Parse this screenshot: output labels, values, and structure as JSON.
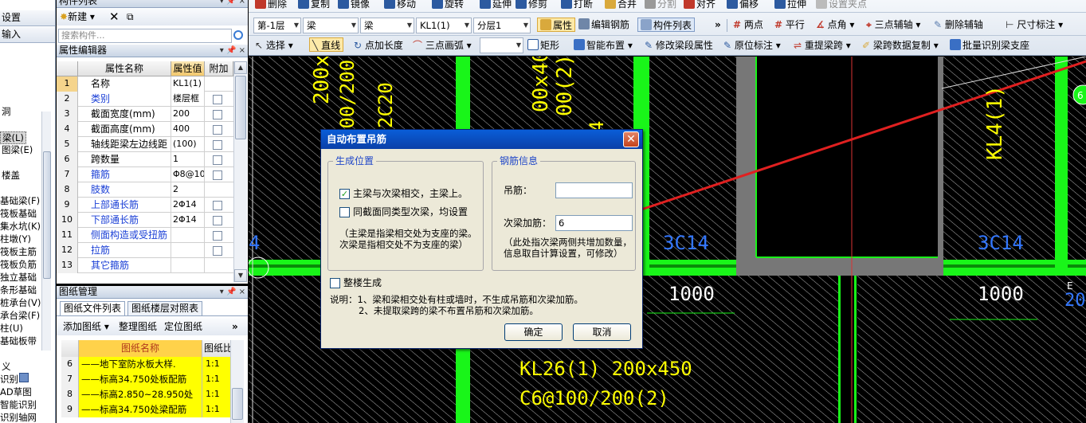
{
  "left_strip": {
    "buttons": [
      "设置",
      "输入"
    ],
    "items": [
      "洞",
      "梁(L)",
      "图梁(E)",
      "楼盖",
      "基础梁(F)",
      "筏板基础",
      "集水坑(K)",
      "柱墩(Y)",
      "筏板主筋",
      "筏板负筋",
      "独立基础",
      "条形基础",
      "桩承台(V)",
      "承台梁(F)",
      "柱(U)",
      "基础板带",
      "义",
      "识别",
      "AD草图",
      "智能识别",
      "识别轴网"
    ]
  },
  "component_list": {
    "title": "构件列表",
    "new_label": "新建",
    "search_placeholder": "搜索构件..."
  },
  "property_editor": {
    "title": "属性编辑器",
    "columns": [
      "属性名称",
      "属性值",
      "附加"
    ],
    "rows": [
      {
        "num": "1",
        "name": "名称",
        "value": "KL1(1)",
        "blue": false,
        "check": false,
        "selected": true
      },
      {
        "num": "2",
        "name": "类别",
        "value": "楼层框",
        "blue": true,
        "check": true
      },
      {
        "num": "3",
        "name": "截面宽度(mm)",
        "value": "200",
        "blue": false,
        "check": true
      },
      {
        "num": "4",
        "name": "截面高度(mm)",
        "value": "400",
        "blue": false,
        "check": true
      },
      {
        "num": "5",
        "name": "轴线距梁左边线距",
        "value": "(100)",
        "blue": false,
        "check": true
      },
      {
        "num": "6",
        "name": "跨数量",
        "value": "1",
        "blue": false,
        "check": true
      },
      {
        "num": "7",
        "name": "箍筋",
        "value": "Φ8@10",
        "blue": true,
        "check": true
      },
      {
        "num": "8",
        "name": "肢数",
        "value": "2",
        "blue": true,
        "check": false
      },
      {
        "num": "9",
        "name": "上部通长筋",
        "value": "2Φ14",
        "blue": true,
        "check": true
      },
      {
        "num": "10",
        "name": "下部通长筋",
        "value": "2Φ14",
        "blue": true,
        "check": true
      },
      {
        "num": "11",
        "name": "侧面构造或受扭筋",
        "value": "",
        "blue": true,
        "check": true
      },
      {
        "num": "12",
        "name": "拉筋",
        "value": "",
        "blue": true,
        "check": true
      },
      {
        "num": "13",
        "name": "其它箍筋",
        "value": "",
        "blue": true,
        "check": false
      }
    ]
  },
  "drawing_management": {
    "title": "图纸管理",
    "tabs": [
      "图纸文件列表",
      "图纸楼层对照表"
    ],
    "buttons": [
      "添加图纸",
      "整理图纸",
      "定位图纸"
    ],
    "columns": [
      "图纸名称",
      "图纸比"
    ],
    "rows": [
      {
        "num": "6",
        "name": "——地下室防水板大样.",
        "scale": "1:1"
      },
      {
        "num": "7",
        "name": "——标高34.750处板配筋",
        "scale": "1:1"
      },
      {
        "num": "8",
        "name": "——标高2.850~28.950处",
        "scale": "1:1"
      },
      {
        "num": "9",
        "name": "——标高34.750处梁配筋",
        "scale": "1:1"
      }
    ]
  },
  "toolbar": {
    "row1": [
      "删除",
      "复制",
      "镜像",
      "移动",
      "旋转",
      "延伸",
      "修剪",
      "打断",
      "合并",
      "分割",
      "对齐",
      "偏移",
      "拉伸",
      "设置夹点"
    ],
    "row2": {
      "floor": "第-1层",
      "type1": "梁",
      "type2": "梁",
      "component": "KL1(1)",
      "layer": "分层1",
      "buttons": [
        "属性",
        "编辑钢筋",
        "构件列表",
        "两点",
        "平行",
        "点角",
        "三点辅轴",
        "删除辅轴",
        "尺寸标注"
      ]
    },
    "row3": [
      "选择",
      "直线",
      "点加长度",
      "三点画弧",
      "矩形",
      "智能布置",
      "修改梁段属性",
      "原位标注",
      "重提梁跨",
      "梁跨数据复制",
      "批量识别梁支座"
    ]
  },
  "canvas": {
    "texts": {
      "t200x": "200x",
      "t100_200": "100/200(",
      "t2c20": "2C20",
      "t00x400": "00x400",
      "t00_2": "00(2)",
      "t4": "4",
      "kl4": "KL4(1)",
      "c14_a": "3C14",
      "c14_b": "3C14",
      "dim1": "1000",
      "dim2": "1000",
      "left4": "4",
      "kl26": "KL26(1) 200x450",
      "c6": "C6@100/200(2)",
      "circle_label": "6",
      "circle_letter": "E",
      "edge_num": "20"
    }
  },
  "dialog": {
    "title": "自动布置吊筋",
    "group_position": "生成位置",
    "opt1": "主梁与次梁相交，主梁上。",
    "opt2": "同截面同类型次梁，均设置",
    "note1": "（主梁是指梁相交处为支座的梁。",
    "note2": "次梁是指相交处不为支座的梁）",
    "group_rebar": "钢筋信息",
    "hanger_label": "吊筋：",
    "hanger_value": "",
    "secondary_label": "次梁加筋：",
    "secondary_value": "6",
    "rebar_note1": "（此处指次梁两侧共增加数量，",
    "rebar_note2": "信息取自计算设置，可修改）",
    "whole_floor": "整楼生成",
    "desc1": "说明：1、梁和梁相交处有柱或墙时，不生成吊筋和次梁加筋。",
    "desc2": "2、未提取梁跨的梁不布置吊筋和次梁加筋。",
    "ok": "确定",
    "cancel": "取消"
  },
  "colors": {
    "beam_green": "#19f519",
    "annotation_yellow": "#ffff00",
    "annotation_blue": "#3377ff",
    "arrow_red": "#e02020"
  }
}
